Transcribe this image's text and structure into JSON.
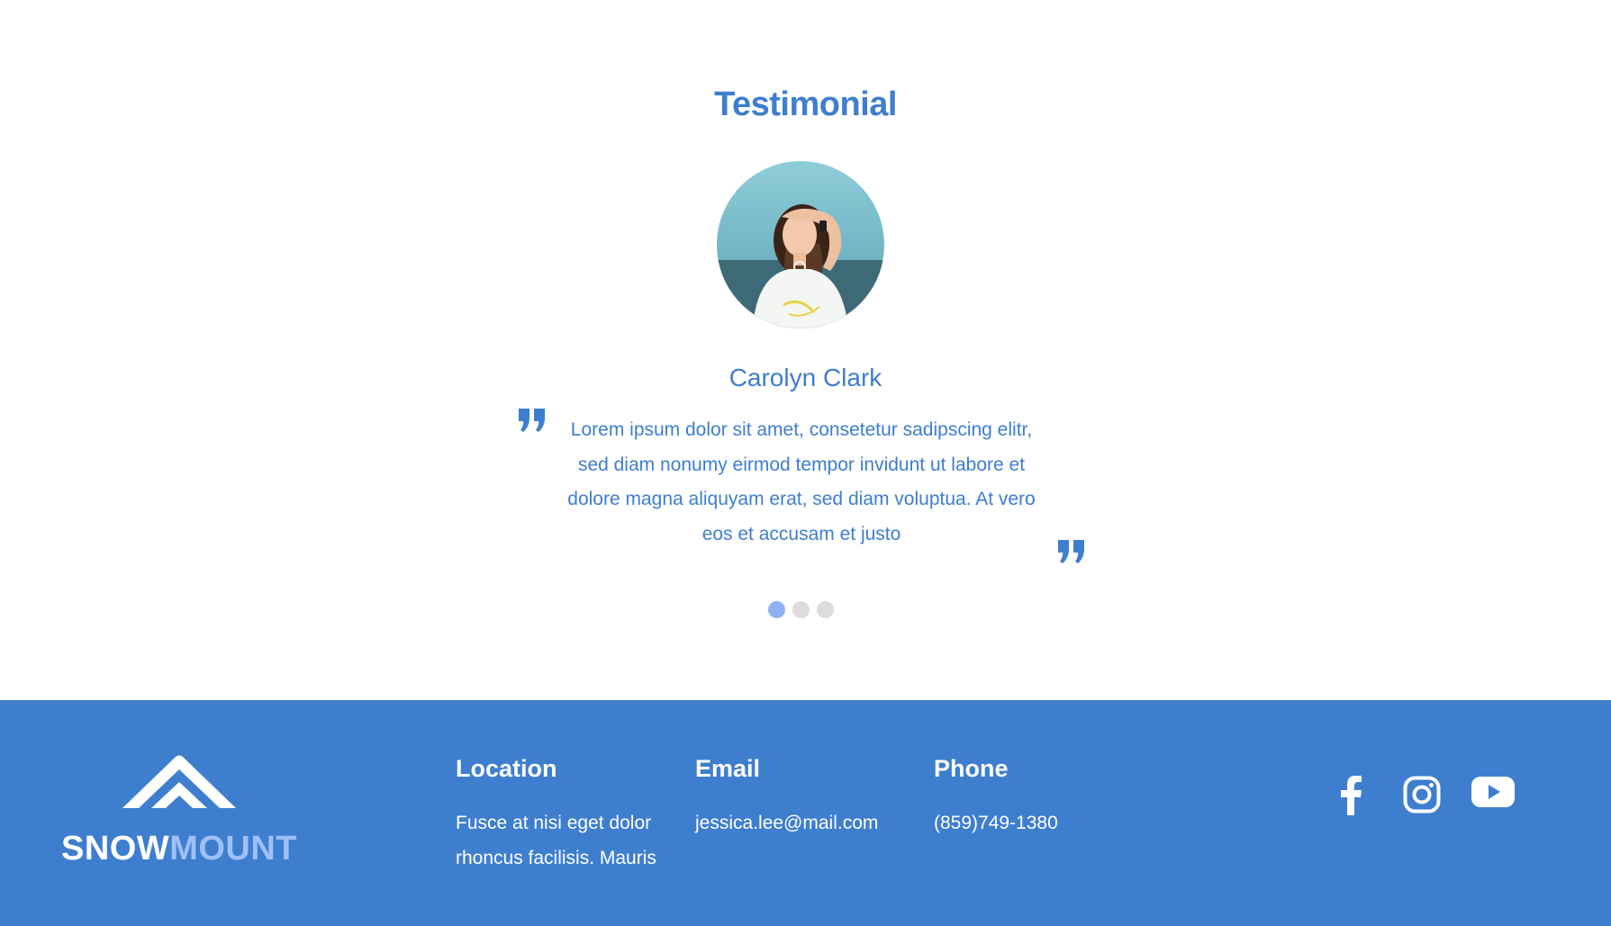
{
  "testimonial": {
    "title": "Testimonial",
    "name": "Carolyn Clark",
    "text": "Lorem ipsum dolor sit amet, consetetur sadipscing elitr, sed diam nonumy eirmod tempor invidunt ut labore et dolore magna aliquyam erat, sed diam voluptua. At vero eos et accusam et justo",
    "slides": 3,
    "active_slide": 1,
    "avatar_icon": "person-photo"
  },
  "footer": {
    "brand": {
      "part1": "SNOW",
      "part2": "MOUNT",
      "icon": "mountain-logo-icon"
    },
    "location": {
      "heading": "Location",
      "text": "Fusce at nisi eget dolor rhoncus facilisis. Mauris"
    },
    "email": {
      "heading": "Email",
      "text": "jessica.lee@mail.com"
    },
    "phone": {
      "heading": "Phone",
      "text": "(859)749-1380"
    },
    "social": [
      "facebook-icon",
      "instagram-icon",
      "youtube-icon"
    ]
  },
  "colors": {
    "accent": "#3d7ecf",
    "footer_bg": "#3e7ecf",
    "brand_light": "#9ec0f6",
    "dot_active": "#8fb1f3",
    "dot_inactive": "#dcdcdc"
  }
}
